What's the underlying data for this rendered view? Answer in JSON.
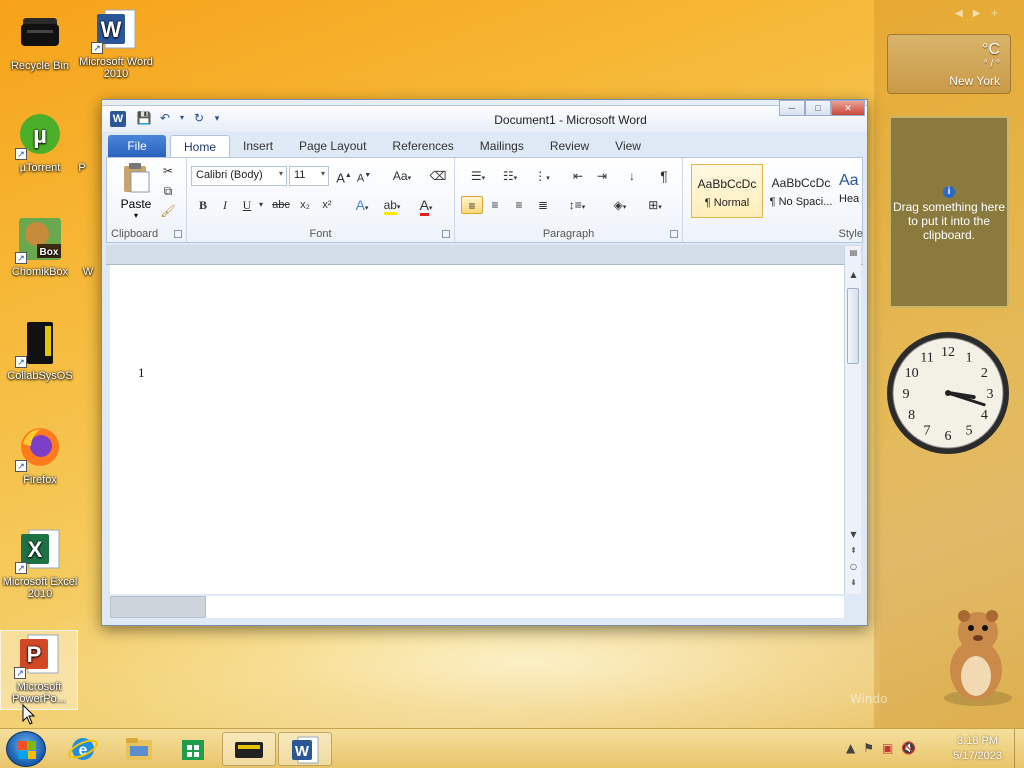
{
  "desktop": {
    "icons": [
      {
        "label": "Recycle Bin"
      },
      {
        "label": "Microsoft Word 2010"
      },
      {
        "label": "µTorrent"
      },
      {
        "label": "ChomikBox"
      },
      {
        "label": "CollabSysOS"
      },
      {
        "label": "Firefox"
      },
      {
        "label": "Microsoft Excel 2010"
      },
      {
        "label": "Microsoft PowerPo..."
      }
    ],
    "partial_labels": [
      "P",
      "W"
    ]
  },
  "gadgets": {
    "weather": {
      "unit": "°C",
      "range": "° / °",
      "city": "New York"
    },
    "clipboard": {
      "info": "i",
      "message": "Drag something here to put it into the clipboard."
    },
    "clock": {
      "numbers": [
        "12",
        "1",
        "2",
        "3",
        "4",
        "5",
        "6",
        "7",
        "8",
        "9",
        "10",
        "11"
      ],
      "hour": 3,
      "minute": 18
    },
    "watermark": "Windo"
  },
  "word": {
    "title": "Document1  -  Microsoft Word",
    "app_letter": "W",
    "tabs": {
      "file": "File",
      "home": "Home",
      "insert": "Insert",
      "page_layout": "Page Layout",
      "references": "References",
      "mailings": "Mailings",
      "review": "Review",
      "view": "View"
    },
    "ribbon": {
      "clipboard": {
        "label": "Clipboard",
        "paste": "Paste"
      },
      "font": {
        "label": "Font",
        "family": "Calibri (Body)",
        "size": "11",
        "grow": "A",
        "shrink": "A",
        "case": "Aa",
        "bold": "B",
        "italic": "I",
        "underline": "U",
        "strike": "abc",
        "subscript": "x₂",
        "superscript": "x²",
        "color_letter": "A"
      },
      "paragraph": {
        "label": "Paragraph",
        "pilcrow": "¶"
      },
      "styles": {
        "label": "Style",
        "items": [
          {
            "sample": "AaBbCcDc",
            "name": "¶ Normal"
          },
          {
            "sample": "AaBbCcDc",
            "name": "¶ No Spaci..."
          },
          {
            "sample": "Aa",
            "name": "Hea"
          }
        ]
      }
    },
    "document": {
      "line_number": "1"
    }
  },
  "taskbar": {
    "time": "3:18 PM",
    "date": "5/17/2023"
  },
  "colors": {
    "word_blue": "#2b5797",
    "file_tab": "#2a63bf",
    "taskbar": "#e8c56a"
  }
}
